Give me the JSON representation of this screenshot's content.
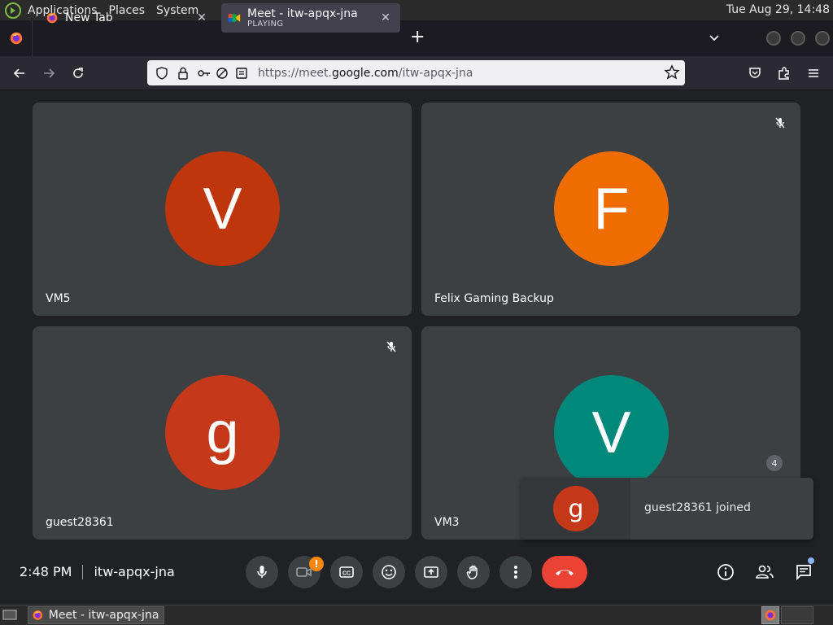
{
  "panel": {
    "menus": [
      "Applications",
      "Places",
      "System"
    ],
    "clock": "Tue Aug 29, 14:48"
  },
  "tabs": [
    {
      "title": "New Tab",
      "subtitle": "",
      "active": false
    },
    {
      "title": "Meet - itw-apqx-jna",
      "subtitle": "PLAYING",
      "active": true
    }
  ],
  "urlbar": {
    "url_prefix": "https://meet.",
    "url_domain": "google.com",
    "url_path": "/itw-apqx-jna"
  },
  "participants": [
    {
      "name": "VM5",
      "initial": "V",
      "color": "#bf360c",
      "muted": false
    },
    {
      "name": "Felix Gaming Backup",
      "initial": "F",
      "color": "#ef6c00",
      "muted": true
    },
    {
      "name": "guest28361",
      "initial": "g",
      "color": "#c5381a",
      "muted": true
    },
    {
      "name": "VM3",
      "initial": "V",
      "color": "#00897b",
      "muted": false
    }
  ],
  "toast": {
    "initial": "g",
    "message": "guest28361 joined"
  },
  "meeting": {
    "time": "2:48 PM",
    "code": "itw-apqx-jna"
  },
  "controls": {
    "camera_badge": "!",
    "participant_count": "4"
  },
  "taskbar": {
    "window_title": "Meet - itw-apqx-jna ..."
  },
  "colors": {
    "hangup": "#ea4335",
    "control_bg": "#3c4043",
    "alert_badge": "#f9880d"
  }
}
